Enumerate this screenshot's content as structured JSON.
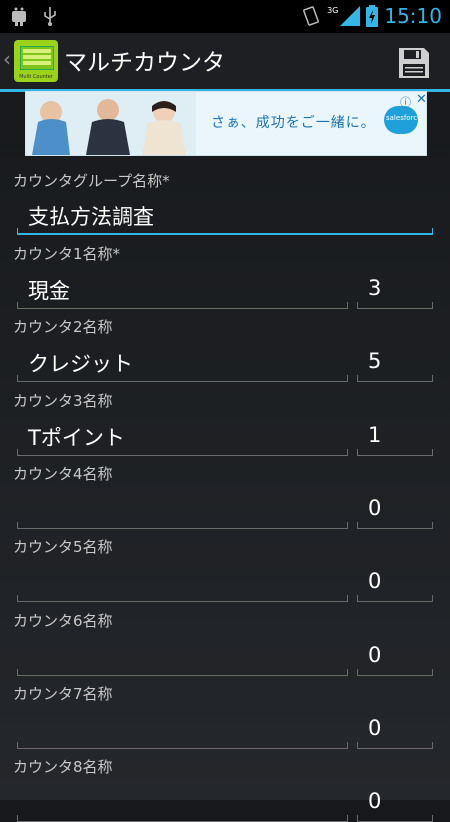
{
  "status_bar": {
    "time": "15:10",
    "network": "3G"
  },
  "action_bar": {
    "title": "マルチカウンタ",
    "icon_label": "Multi Counter"
  },
  "ad": {
    "text": "さぁ、成功をご一緒に。",
    "brand": "salesforce"
  },
  "group": {
    "label": "カウンタグループ名称*",
    "value": "支払方法調査"
  },
  "counters": [
    {
      "label": "カウンタ1名称*",
      "name": "現金",
      "count": "3"
    },
    {
      "label": "カウンタ2名称",
      "name": "クレジット",
      "count": "5"
    },
    {
      "label": "カウンタ3名称",
      "name": "Tポイント",
      "count": "1"
    },
    {
      "label": "カウンタ4名称",
      "name": "",
      "count": "0"
    },
    {
      "label": "カウンタ5名称",
      "name": "",
      "count": "0"
    },
    {
      "label": "カウンタ6名称",
      "name": "",
      "count": "0"
    },
    {
      "label": "カウンタ7名称",
      "name": "",
      "count": "0"
    },
    {
      "label": "カウンタ8名称",
      "name": "",
      "count": "0"
    }
  ],
  "colors": {
    "accent": "#33b5e5",
    "actionbar": "#1e1f22"
  }
}
